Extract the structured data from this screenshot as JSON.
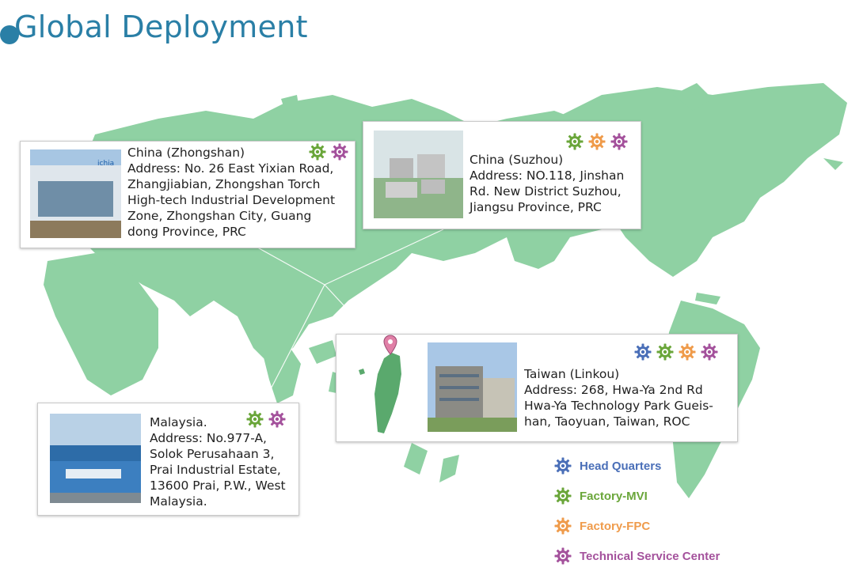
{
  "page": {
    "title": "Global Deployment"
  },
  "colors": {
    "title": "#2a7fa6",
    "land": "#8fd1a3",
    "taiwan": "#5aa96d",
    "head_quarters": "#4a6fb8",
    "factory_mvi": "#6aa63a",
    "factory_fpc": "#ef9b4b",
    "technical_service_center": "#a4529c"
  },
  "legend": [
    {
      "key": "head_quarters",
      "label": "Head Quarters",
      "color": "#4a6fb8",
      "icon": "gear-icon"
    },
    {
      "key": "factory_mvi",
      "label": "Factory-MVI",
      "color": "#6aa63a",
      "icon": "gear-icon"
    },
    {
      "key": "factory_fpc",
      "label": "Factory-FPC",
      "color": "#ef9b4b",
      "icon": "gear-icon"
    },
    {
      "key": "technical_service_center",
      "label": "Technical Service Center",
      "color": "#a4529c",
      "icon": "gear-icon"
    }
  ],
  "locations": {
    "zhongshan": {
      "name": "China (Zhongshan)",
      "address": [
        "Address: No. 26 East Yixian Road,",
        "Zhangjiabian, Zhongshan Torch",
        "High-tech Industrial Development",
        "Zone, Zhongshan City, Guang",
        "dong Province, PRC"
      ],
      "facilities": [
        "factory_mvi",
        "technical_service_center"
      ]
    },
    "suzhou": {
      "name": "China (Suzhou)",
      "address": [
        "Address: NO.118, Jinshan",
        "Rd. New District Suzhou,",
        "Jiangsu Province, PRC"
      ],
      "facilities": [
        "factory_mvi",
        "factory_fpc",
        "technical_service_center"
      ]
    },
    "taiwan": {
      "name": "Taiwan (Linkou)",
      "address": [
        "Address: 268, Hwa-Ya 2nd Rd",
        "Hwa-Ya Technology Park Gueis-",
        "han, Taoyuan, Taiwan, ROC"
      ],
      "facilities": [
        "head_quarters",
        "factory_mvi",
        "factory_fpc",
        "technical_service_center"
      ]
    },
    "malaysia": {
      "name": "Malaysia.",
      "address": [
        "Address: No.977-A,",
        "Solok Perusahaan 3,",
        "Prai Industrial Estate,",
        "13600 Prai, P.W., West",
        "Malaysia."
      ],
      "facilities": [
        "factory_mvi",
        "technical_service_center"
      ]
    }
  }
}
